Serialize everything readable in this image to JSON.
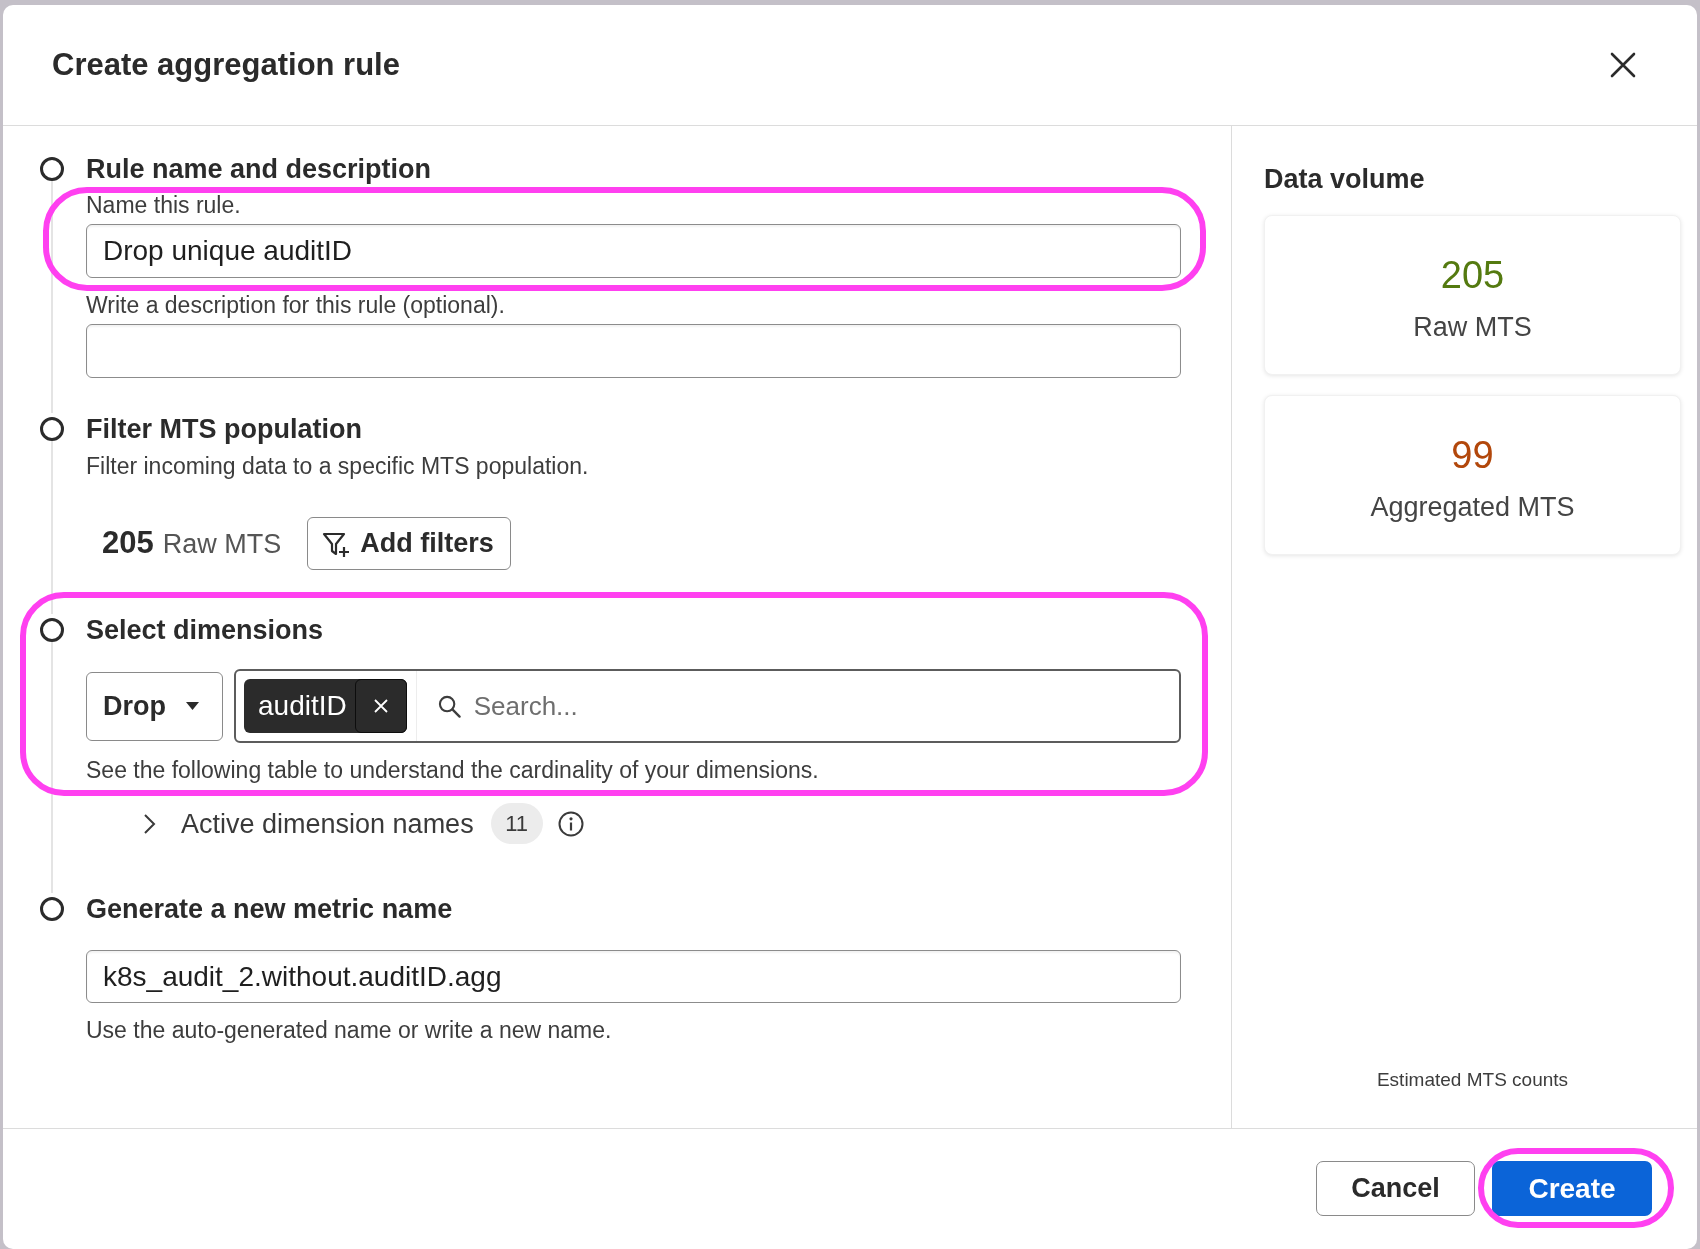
{
  "dialog": {
    "title": "Create aggregation rule"
  },
  "steps": [
    {
      "kind": "name",
      "title": "Rule name and description",
      "highlighted": false,
      "fields": [
        {
          "label": "Name this rule.",
          "value": "Drop unique auditID",
          "highlighted": true
        },
        {
          "label": "Write a description for this rule (optional).",
          "highlighted": false
        }
      ]
    },
    {
      "kind": "filter",
      "title": "Filter MTS population",
      "highlighted": false,
      "description": "Filter incoming data to a specific MTS population.",
      "count": {
        "value": "205",
        "label": "Raw MTS"
      },
      "button": "Add filters"
    },
    {
      "kind": "dimensions",
      "title": "Select dimensions",
      "highlighted": true,
      "mode": "Drop",
      "tags": [
        {
          "label": "auditID"
        }
      ],
      "search": {
        "placeholder": "Search..."
      },
      "help": "See the following table to understand the cardinality of your dimensions.",
      "expander": {
        "label": "Active dimension names",
        "count": "11",
        "expanded": false
      }
    },
    {
      "kind": "metric",
      "title": "Generate a new metric name",
      "highlighted": false,
      "value": "k8s_audit_2.without.auditID.agg",
      "help": "Use the auto-generated name or write a new name."
    }
  ],
  "data_volume": {
    "title": "Data volume",
    "cards": [
      {
        "value": "205",
        "label": "Raw MTS",
        "color": "#547a10"
      },
      {
        "value": "99",
        "label": "Aggregated MTS",
        "color": "#b2470b"
      }
    ],
    "note": "Estimated MTS counts"
  },
  "footer": {
    "buttons": [
      {
        "label": "Cancel",
        "kind": "secondary",
        "highlighted": false
      },
      {
        "label": "Create",
        "kind": "primary",
        "highlighted": true
      }
    ]
  }
}
